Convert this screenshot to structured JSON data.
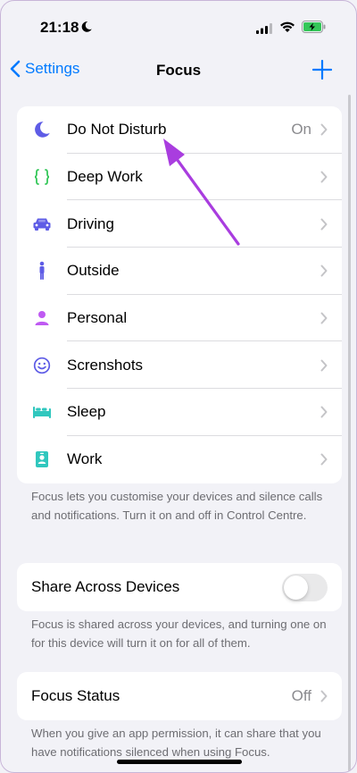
{
  "status_bar": {
    "time": "21:18"
  },
  "nav": {
    "back_label": "Settings",
    "title": "Focus"
  },
  "focus_modes": [
    {
      "label": "Do Not Disturb",
      "value": "On",
      "icon": "moon-icon",
      "color": "#5e5ce6"
    },
    {
      "label": "Deep Work",
      "value": "",
      "icon": "braces-icon",
      "color": "#34c759"
    },
    {
      "label": "Driving",
      "value": "",
      "icon": "car-icon",
      "color": "#5e5ce6"
    },
    {
      "label": "Outside",
      "value": "",
      "icon": "person-standing-icon",
      "color": "#5e5ce6"
    },
    {
      "label": "Personal",
      "value": "",
      "icon": "person-icon",
      "color": "#bf5af2"
    },
    {
      "label": "Screnshots",
      "value": "",
      "icon": "smiley-icon",
      "color": "#5e5ce6"
    },
    {
      "label": "Sleep",
      "value": "",
      "icon": "bed-icon",
      "color": "#30c7be"
    },
    {
      "label": "Work",
      "value": "",
      "icon": "badge-icon",
      "color": "#30c7be"
    }
  ],
  "focus_footnote": "Focus lets you customise your devices and silence calls and notifications. Turn it on and off in Control Centre.",
  "share_across": {
    "label": "Share Across Devices",
    "enabled": false
  },
  "share_footnote": "Focus is shared across your devices, and turning one on for this device will turn it on for all of them.",
  "focus_status": {
    "label": "Focus Status",
    "value": "Off"
  },
  "status_footnote": "When you give an app permission, it can share that you have notifications silenced when using Focus.",
  "colors": {
    "accent": "#007aff",
    "annotation_arrow": "#a93ddf",
    "background": "#f2f2f7"
  }
}
